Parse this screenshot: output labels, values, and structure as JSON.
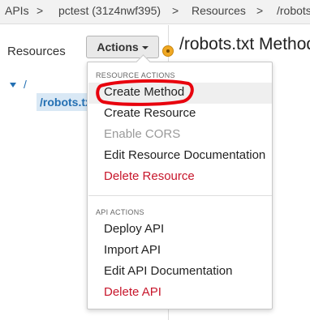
{
  "breadcrumb": {
    "items": [
      "APIs",
      ">",
      "pctest (31z4nwf395)",
      ">",
      "Resources",
      ">",
      "/robots"
    ]
  },
  "left_panel": {
    "heading": "Resources",
    "actions_button": "Actions",
    "tree_root": "/",
    "tree_child": "/robots.txt"
  },
  "main": {
    "title": "/robots.txt Methods"
  },
  "dropdown": {
    "resource_actions_label": "RESOURCE ACTIONS",
    "resource_actions": [
      "Create Method",
      "Create Resource",
      "Enable CORS",
      "Edit Resource Documentation",
      "Delete Resource"
    ],
    "api_actions_label": "API ACTIONS",
    "api_actions": [
      "Deploy API",
      "Import API",
      "Edit API Documentation",
      "Delete API"
    ]
  },
  "colors": {
    "link_blue": "#2470b3",
    "danger_red": "#c7162b",
    "annotation_red": "#e8000d",
    "status_orange": "#f0a823"
  },
  "icons": {
    "status": "orange-dot-icon",
    "caret": "caret-down-icon",
    "tree_toggle": "triangle-down-icon"
  }
}
